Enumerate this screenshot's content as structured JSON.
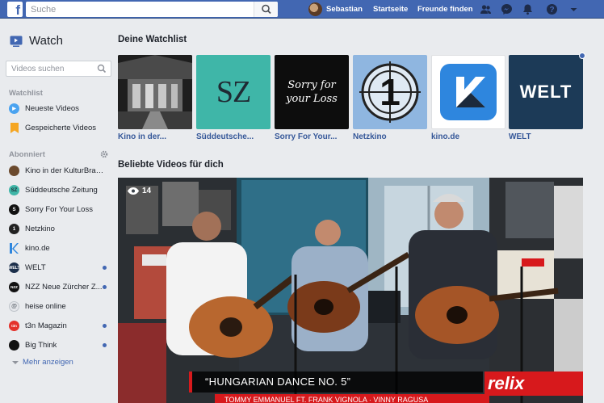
{
  "topbar": {
    "logo": "f",
    "search_placeholder": "Suche",
    "user_name": "Sebastian",
    "nav_home": "Startseite",
    "nav_friends": "Freunde finden",
    "icons": [
      "friend-requests-icon",
      "messenger-icon",
      "notifications-icon",
      "help-icon",
      "account-menu-icon"
    ]
  },
  "sidebar": {
    "title": "Watch",
    "search_placeholder": "Videos suchen",
    "watchlist_heading": "Watchlist",
    "watchlist_items": [
      {
        "label": "Neueste Videos",
        "icon": "play-icon"
      },
      {
        "label": "Gespeicherte Videos",
        "icon": "bookmark-icon"
      }
    ],
    "subscribed_heading": "Abonniert",
    "subscribed_items": [
      {
        "label": "Kino in der KulturBraue...",
        "color": "#6b4a2e",
        "glyph": "",
        "new": false
      },
      {
        "label": "Süddeutsche Zeitung",
        "color": "#3fb6a8",
        "glyph": "SZ",
        "new": false
      },
      {
        "label": "Sorry For Your Loss",
        "color": "#111111",
        "glyph": "S",
        "new": false
      },
      {
        "label": "Netzkino",
        "color": "#222222",
        "glyph": "1",
        "new": false
      },
      {
        "label": "kino.de",
        "color": "#ffffff",
        "glyph": "k",
        "new": false
      },
      {
        "label": "WELT",
        "color": "#1c2f4b",
        "glyph": "W",
        "new": true
      },
      {
        "label": "NZZ Neue Zürcher Z...",
        "color": "#111111",
        "glyph": "NZZ",
        "new": true
      },
      {
        "label": "heise online",
        "color": "#cfd3d8",
        "glyph": "",
        "new": false
      },
      {
        "label": "t3n Magazin",
        "color": "#e4322b",
        "glyph": "t3n",
        "new": true
      },
      {
        "label": "Big Think",
        "color": "#111111",
        "glyph": "",
        "new": true
      }
    ],
    "more_label": "Mehr anzeigen"
  },
  "main": {
    "watchlist_heading": "Deine Watchlist",
    "cards": [
      {
        "caption": "Kino in der..."
      },
      {
        "caption": "Süddeutsche...",
        "logo": "SZ"
      },
      {
        "caption": "Sorry For Your...",
        "logo": "Sorry for your Loss"
      },
      {
        "caption": "Netzkino",
        "logo": "1"
      },
      {
        "caption": "kino.de"
      },
      {
        "caption": "WELT",
        "logo": "WELT",
        "new": true
      }
    ],
    "popular_heading": "Beliebte Videos für dich",
    "video": {
      "view_count": "14",
      "lower_third": "“HUNGARIAN DANCE NO. 5”",
      "lower_third_sub": "TOMMY EMMANUEL FT. FRANK VIGNOLA · VINNY RAGUSA",
      "channel_bug": "relix"
    }
  },
  "colors": {
    "brand": "#4267b2",
    "accent_red": "#d7191c"
  }
}
